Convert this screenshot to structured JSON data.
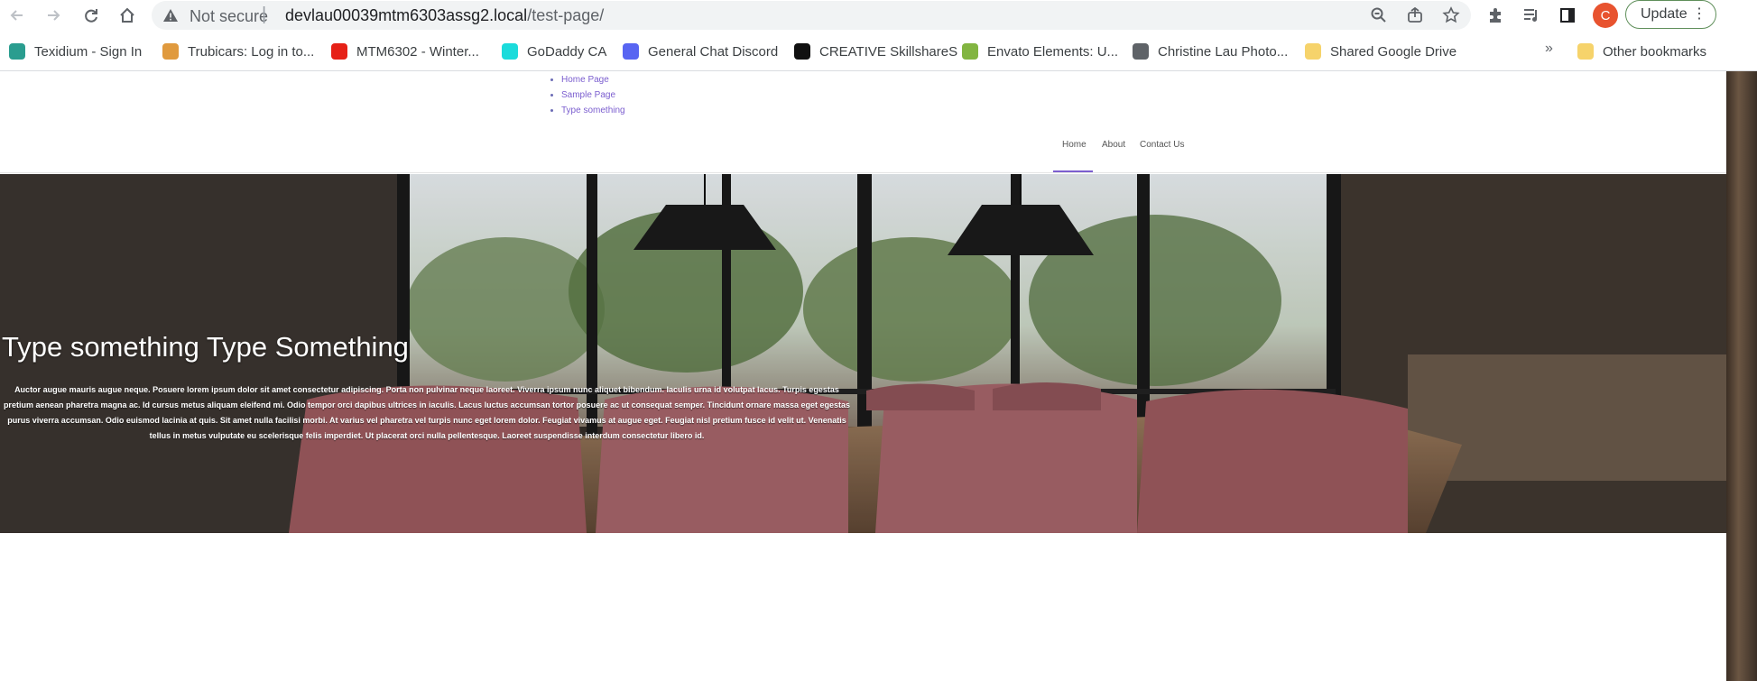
{
  "browser": {
    "security_label": "Not secure",
    "url_host": "devlau00039mtm6303assg2.local",
    "url_path": "/test-page/",
    "profile_initial": "C",
    "update_label": "Update"
  },
  "bookmarks": [
    {
      "label": "Texidium - Sign In",
      "icon": "texidium-icon",
      "color": "#2a9d8f"
    },
    {
      "label": "Trubicars: Log in to...",
      "icon": "trubicars-icon",
      "color": "#e09a3e"
    },
    {
      "label": "MTM6302 - Winter...",
      "icon": "youtube-icon",
      "color": "#e62117"
    },
    {
      "label": "GoDaddy CA",
      "icon": "godaddy-icon",
      "color": "#1bdbdb"
    },
    {
      "label": "General Chat Discord",
      "icon": "discord-icon",
      "color": "#5865f2"
    },
    {
      "label": "CREATIVE SkillshareS",
      "icon": "skillshare-icon",
      "color": "#111111"
    },
    {
      "label": "Envato Elements: U...",
      "icon": "envato-icon",
      "color": "#82b541"
    },
    {
      "label": "Christine Lau Photo...",
      "icon": "globe-icon",
      "color": "#5f6368"
    },
    {
      "label": "Shared Google Drive",
      "icon": "folder-icon",
      "color": "#f6d36b"
    }
  ],
  "bookmarks_overflow": "»",
  "other_bookmarks": "Other bookmarks",
  "site": {
    "page_list": [
      "Home Page",
      "Sample Page",
      "Type something"
    ],
    "nav": [
      "Home",
      "About",
      "Contact Us"
    ],
    "active_nav": "Home",
    "accent_color": "#7b5ecf"
  },
  "hero": {
    "title": "Type something Type Something",
    "body": "Auctor augue mauris augue neque. Posuere lorem ipsum dolor sit amet consectetur adipiscing. Porta non pulvinar neque laoreet. Viverra ipsum nunc aliquet bibendum. Iaculis urna id volutpat lacus. Turpis egestas pretium aenean pharetra magna ac. Id cursus metus aliquam eleifend mi. Odio tempor orci dapibus ultrices in iaculis. Lacus luctus accumsan tortor posuere ac ut consequat semper. Tincidunt ornare massa eget egestas purus viverra accumsan. Odio euismod lacinia at quis. Sit amet nulla facilisi morbi. At varius vel pharetra vel turpis nunc eget lorem dolor. Feugiat vivamus at augue eget. Feugiat nisl pretium fusce id velit ut. Venenatis tellus in metus vulputate eu scelerisque felis imperdiet. Ut placerat orci nulla pellentesque. Laoreet suspendisse interdum consectetur libero id."
  }
}
